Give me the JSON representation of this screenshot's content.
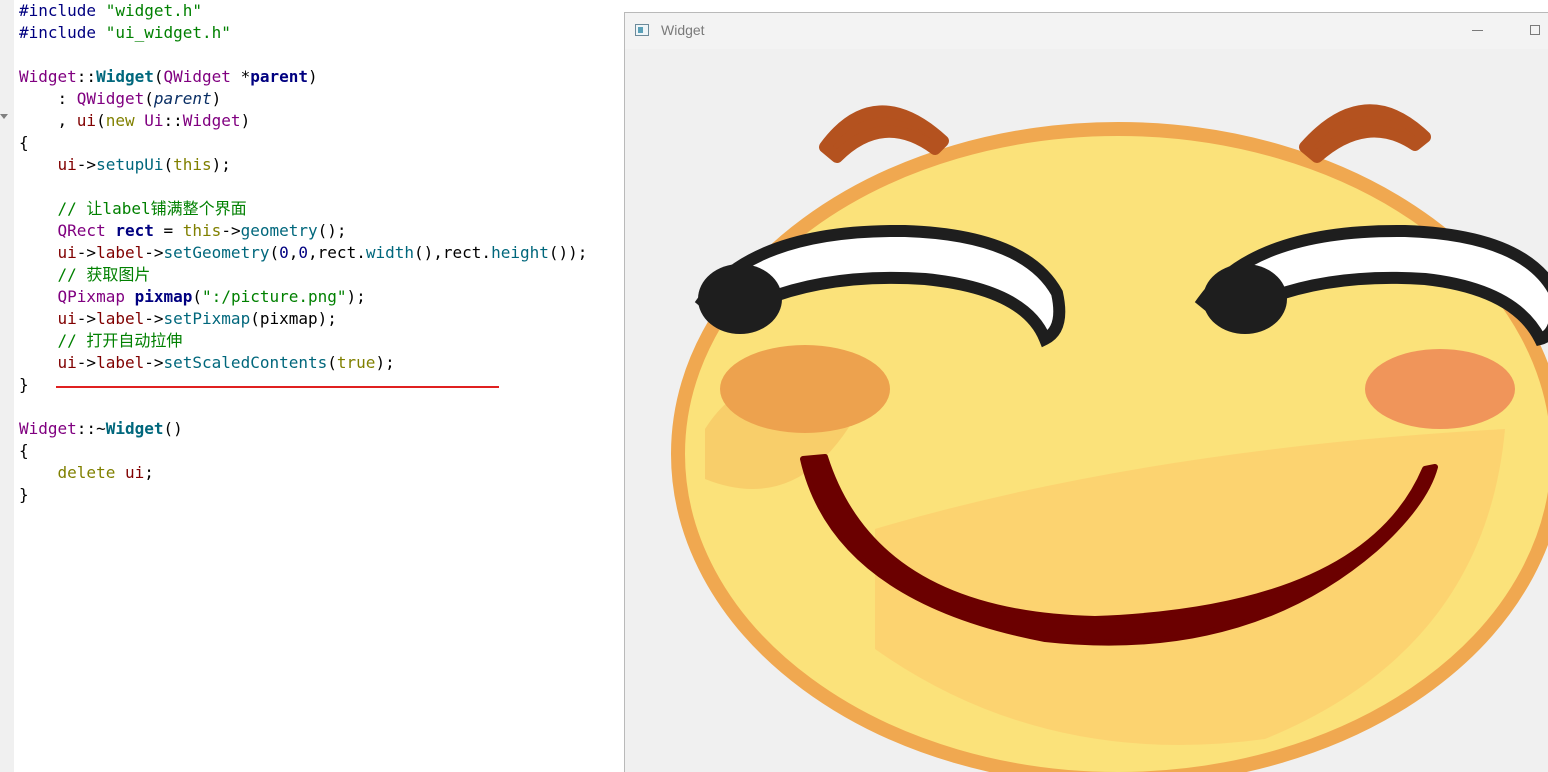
{
  "editor": {
    "lines": [
      [
        {
          "c": "t-pp",
          "t": "#include "
        },
        {
          "c": "t-str",
          "t": "\"widget.h\""
        }
      ],
      [
        {
          "c": "t-pp",
          "t": "#include "
        },
        {
          "c": "t-str",
          "t": "\"ui_widget.h\""
        }
      ],
      [],
      [
        {
          "c": "t-type",
          "t": "Widget"
        },
        {
          "c": "t-id",
          "t": "::"
        },
        {
          "c": "t-fnb",
          "t": "Widget"
        },
        {
          "c": "t-id",
          "t": "("
        },
        {
          "c": "t-type",
          "t": "QWidget"
        },
        {
          "c": "t-id",
          "t": " *"
        },
        {
          "c": "t-idb",
          "t": "parent"
        },
        {
          "c": "t-id",
          "t": ")"
        }
      ],
      [
        {
          "c": "t-id",
          "t": "    : "
        },
        {
          "c": "t-type",
          "t": "QWidget"
        },
        {
          "c": "t-id",
          "t": "("
        },
        {
          "c": "t-par",
          "t": "parent"
        },
        {
          "c": "t-id",
          "t": ")"
        }
      ],
      [
        {
          "c": "t-id",
          "t": "    , "
        },
        {
          "c": "t-mem",
          "t": "ui"
        },
        {
          "c": "t-id",
          "t": "("
        },
        {
          "c": "t-kw",
          "t": "new "
        },
        {
          "c": "t-type",
          "t": "Ui"
        },
        {
          "c": "t-id",
          "t": "::"
        },
        {
          "c": "t-type",
          "t": "Widget"
        },
        {
          "c": "t-id",
          "t": ")"
        }
      ],
      [
        {
          "c": "t-id",
          "t": "{"
        }
      ],
      [
        {
          "c": "t-id",
          "t": "    "
        },
        {
          "c": "t-mem",
          "t": "ui"
        },
        {
          "c": "t-id",
          "t": "->"
        },
        {
          "c": "t-fn",
          "t": "setupUi"
        },
        {
          "c": "t-id",
          "t": "("
        },
        {
          "c": "t-kw",
          "t": "this"
        },
        {
          "c": "t-id",
          "t": ");"
        }
      ],
      [],
      [
        {
          "c": "t-id",
          "t": "    "
        },
        {
          "c": "t-cmt",
          "t": "// 让label铺满整个界面"
        }
      ],
      [
        {
          "c": "t-id",
          "t": "    "
        },
        {
          "c": "t-type",
          "t": "QRect"
        },
        {
          "c": "t-id",
          "t": " "
        },
        {
          "c": "t-idb",
          "t": "rect"
        },
        {
          "c": "t-id",
          "t": " = "
        },
        {
          "c": "t-kw",
          "t": "this"
        },
        {
          "c": "t-id",
          "t": "->"
        },
        {
          "c": "t-fn",
          "t": "geometry"
        },
        {
          "c": "t-id",
          "t": "();"
        }
      ],
      [
        {
          "c": "t-id",
          "t": "    "
        },
        {
          "c": "t-mem",
          "t": "ui"
        },
        {
          "c": "t-id",
          "t": "->"
        },
        {
          "c": "t-mem",
          "t": "label"
        },
        {
          "c": "t-id",
          "t": "->"
        },
        {
          "c": "t-fn",
          "t": "setGeometry"
        },
        {
          "c": "t-id",
          "t": "("
        },
        {
          "c": "t-num",
          "t": "0"
        },
        {
          "c": "t-id",
          "t": ","
        },
        {
          "c": "t-num",
          "t": "0"
        },
        {
          "c": "t-id",
          "t": ",rect."
        },
        {
          "c": "t-fn",
          "t": "width"
        },
        {
          "c": "t-id",
          "t": "(),rect."
        },
        {
          "c": "t-fn",
          "t": "height"
        },
        {
          "c": "t-id",
          "t": "());"
        }
      ],
      [
        {
          "c": "t-id",
          "t": "    "
        },
        {
          "c": "t-cmt",
          "t": "// 获取图片"
        }
      ],
      [
        {
          "c": "t-id",
          "t": "    "
        },
        {
          "c": "t-type",
          "t": "QPixmap"
        },
        {
          "c": "t-id",
          "t": " "
        },
        {
          "c": "t-idb",
          "t": "pixmap"
        },
        {
          "c": "t-id",
          "t": "("
        },
        {
          "c": "t-str",
          "t": "\":/picture.png\""
        },
        {
          "c": "t-id",
          "t": ");"
        }
      ],
      [
        {
          "c": "t-id",
          "t": "    "
        },
        {
          "c": "t-mem",
          "t": "ui"
        },
        {
          "c": "t-id",
          "t": "->"
        },
        {
          "c": "t-mem",
          "t": "label"
        },
        {
          "c": "t-id",
          "t": "->"
        },
        {
          "c": "t-fn",
          "t": "setPixmap"
        },
        {
          "c": "t-id",
          "t": "(pixmap);"
        }
      ],
      [
        {
          "c": "t-id",
          "t": "    "
        },
        {
          "c": "t-cmt",
          "t": "// 打开自动拉伸"
        }
      ],
      [
        {
          "c": "t-id",
          "t": "    "
        },
        {
          "c": "t-mem",
          "t": "ui"
        },
        {
          "c": "t-id",
          "t": "->"
        },
        {
          "c": "t-mem",
          "t": "label"
        },
        {
          "c": "t-id",
          "t": "->"
        },
        {
          "c": "t-fn",
          "t": "setScaledContents"
        },
        {
          "c": "t-id",
          "t": "("
        },
        {
          "c": "t-kw",
          "t": "true"
        },
        {
          "c": "t-id",
          "t": ");"
        }
      ],
      [
        {
          "c": "t-id",
          "t": "}"
        }
      ],
      [],
      [
        {
          "c": "t-type",
          "t": "Widget"
        },
        {
          "c": "t-id",
          "t": "::~"
        },
        {
          "c": "t-fnb",
          "t": "Widget"
        },
        {
          "c": "t-id",
          "t": "()"
        }
      ],
      [
        {
          "c": "t-id",
          "t": "{"
        }
      ],
      [
        {
          "c": "t-id",
          "t": "    "
        },
        {
          "c": "t-kw",
          "t": "delete "
        },
        {
          "c": "t-mem",
          "t": "ui"
        },
        {
          "c": "t-id",
          "t": ";"
        }
      ],
      [
        {
          "c": "t-id",
          "t": "}"
        }
      ]
    ]
  },
  "window": {
    "title": "Widget",
    "minimize_symbol": "—",
    "maximize_symbol": "□"
  },
  "colors": {
    "face_fill": "#fbe27a",
    "face_outline": "#f0a850",
    "brow": "#b4521f",
    "mouth": "#6b0000",
    "blush_left": "#eda24e",
    "blush_right": "#f0955a",
    "eye_outline": "#1e1e1e",
    "underline": "#e02020"
  }
}
